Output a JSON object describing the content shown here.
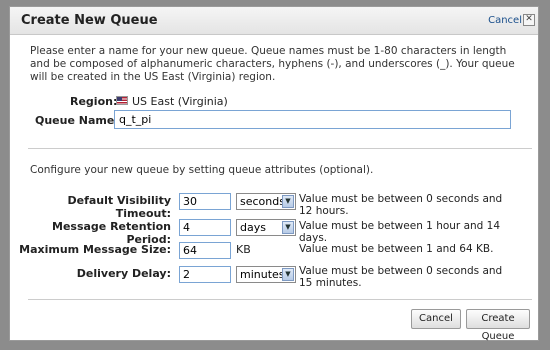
{
  "dialog": {
    "title": "Create New Queue",
    "cancel_link": "Cancel",
    "close_glyph": "✕"
  },
  "intro": "Please enter a name for your new queue. Queue names must be 1-80 characters in length and be composed of alphanumeric characters, hyphens (-), and underscores (_). Your queue will be created in the US East (Virginia) region.",
  "region": {
    "label": "Region:",
    "value": "US East (Virginia)",
    "flag_icon": "us-flag-icon"
  },
  "queue_name": {
    "label": "Queue Name:",
    "value": "q_t_pi"
  },
  "config_text": "Configure your new queue by setting queue attributes (optional).",
  "attributes": {
    "visibility": {
      "label": "Default Visibility Timeout:",
      "value": "30",
      "unit": "seconds",
      "hint": "Value must be between 0 seconds and 12 hours."
    },
    "retention": {
      "label": "Message Retention Period:",
      "value": "4",
      "unit": "days",
      "hint": "Value must be between 1 hour and 14 days."
    },
    "max_size": {
      "label": "Maximum Message Size:",
      "value": "64",
      "unit": "KB",
      "hint": "Value must be between 1 and 64 KB."
    },
    "delay": {
      "label": "Delivery Delay:",
      "value": "2",
      "unit": "minutes",
      "hint": "Value must be between 0 seconds and 15 minutes."
    }
  },
  "buttons": {
    "cancel": "Cancel",
    "create": "Create Queue"
  }
}
